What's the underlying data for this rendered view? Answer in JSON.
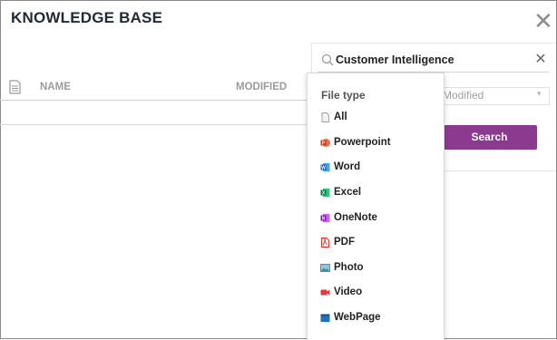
{
  "app": {
    "title": "KNOWLEDGE BASE",
    "close_symbol": "✕"
  },
  "table": {
    "columns": [
      "NAME",
      "MODIFIED"
    ]
  },
  "search": {
    "value": "Customer Intelligence",
    "clear_symbol": "✕",
    "sort_value": "Modified",
    "button_label": "Search"
  },
  "file_type_menu": {
    "header": "File type",
    "items": [
      {
        "label": "All",
        "icon": "generic-file-icon",
        "color": "#9e9e9e"
      },
      {
        "label": "Powerpoint",
        "icon": "powerpoint-icon",
        "color": "#d24726"
      },
      {
        "label": "Word",
        "icon": "word-icon",
        "color": "#2b579a"
      },
      {
        "label": "Excel",
        "icon": "excel-icon",
        "color": "#217346"
      },
      {
        "label": "OneNote",
        "icon": "onenote-icon",
        "color": "#7719aa"
      },
      {
        "label": "PDF",
        "icon": "pdf-icon",
        "color": "#e2231a"
      },
      {
        "label": "Photo",
        "icon": "photo-icon",
        "color": "#3c8ea8"
      },
      {
        "label": "Video",
        "icon": "video-icon",
        "color": "#e53935"
      },
      {
        "label": "WebPage",
        "icon": "webpage-icon",
        "color": "#1e73be"
      }
    ]
  },
  "colors": {
    "accent": "#8b3a8f"
  }
}
